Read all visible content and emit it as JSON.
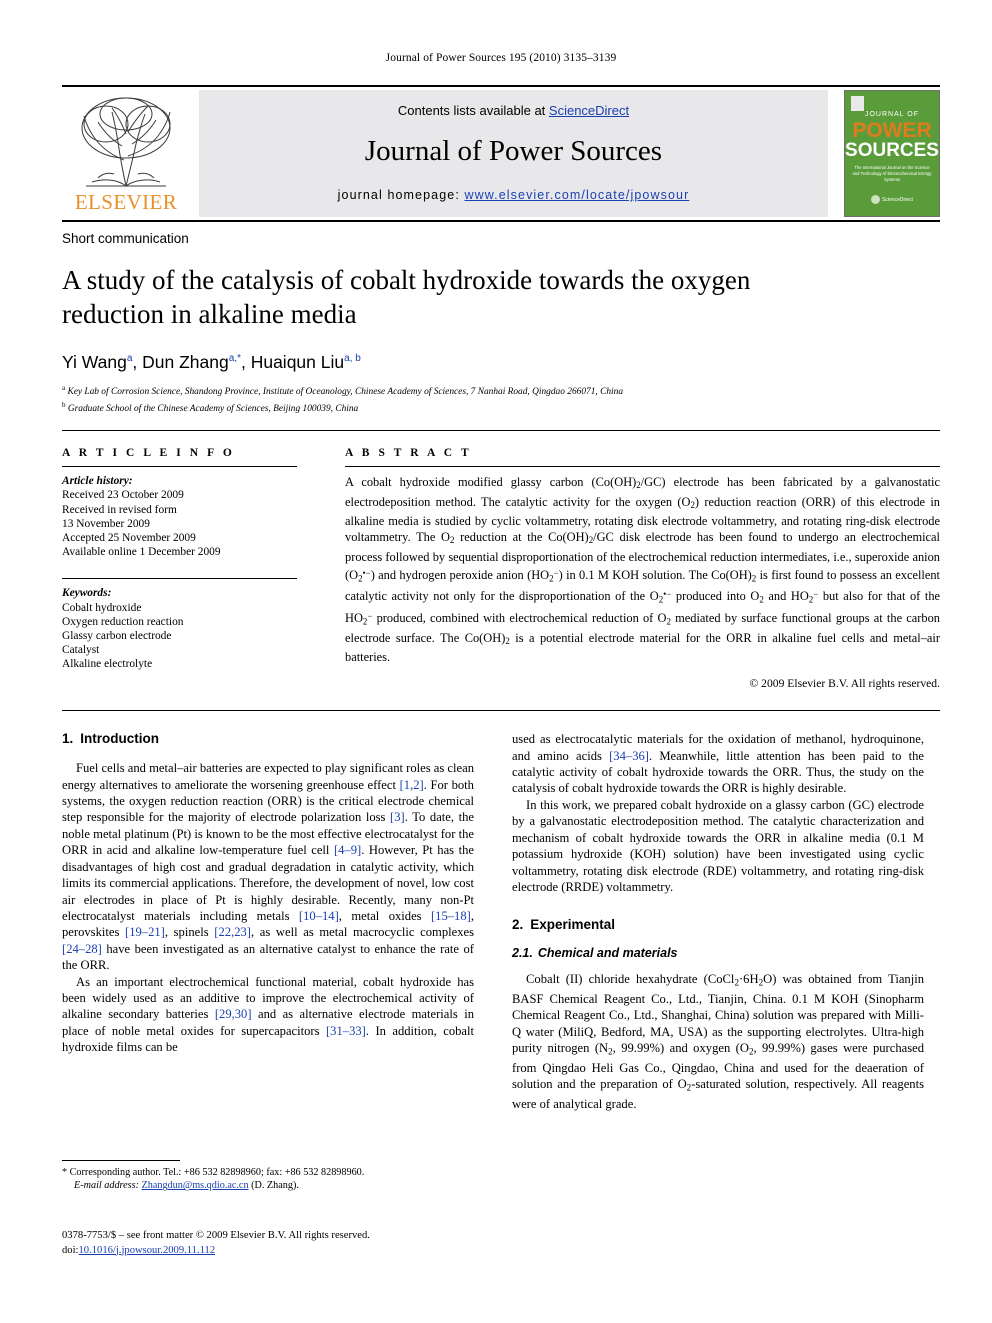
{
  "running_head": "Journal of Power Sources 195 (2010) 3135–3139",
  "masthead": {
    "contents_prefix": "Contents lists available at ",
    "sciencedirect": "ScienceDirect",
    "journal_title": "Journal of Power Sources",
    "homepage_label": "journal homepage:",
    "homepage_url": "www.elsevier.com/locate/jpowsour",
    "publisher": "ELSEVIER",
    "publisher_color": "#E8912B",
    "cover": {
      "line_journal": "JOURNAL OF",
      "line_power": "POWER",
      "line_sources": "SOURCES",
      "subtitle": "The International Journal on the Science and Technology of Electrochemical Energy Systems",
      "footer": "ScienceDirect",
      "bg_color": "#5a9c3a",
      "accent_color": "#e07b20"
    }
  },
  "article": {
    "type": "Short communication",
    "title": "A study of the catalysis of cobalt hydroxide towards the oxygen reduction in alkaline media",
    "authors": [
      {
        "name": "Yi Wang",
        "sup": "a"
      },
      {
        "name": "Dun Zhang",
        "sup": "a,*"
      },
      {
        "name": "Huaiqun Liu",
        "sup": "a, b"
      }
    ],
    "affiliations": [
      {
        "mark": "a",
        "text": "Key Lab of Corrosion Science, Shandong Province, Institute of Oceanology, Chinese Academy of Sciences, 7 Nanhai Road, Qingdao 266071, China"
      },
      {
        "mark": "b",
        "text": "Graduate School of the Chinese Academy of Sciences, Beijing 100039, China"
      }
    ]
  },
  "article_info": {
    "heading": "A R T I C L E   I N F O",
    "history_label": "Article history:",
    "history": [
      "Received 23 October 2009",
      "Received in revised form",
      "13 November 2009",
      "Accepted 25 November 2009",
      "Available online 1 December 2009"
    ],
    "keywords_label": "Keywords:",
    "keywords": [
      "Cobalt hydroxide",
      "Oxygen reduction reaction",
      "Glassy carbon electrode",
      "Catalyst",
      "Alkaline electrolyte"
    ]
  },
  "abstract": {
    "heading": "A B S T R A C T",
    "copyright": "© 2009 Elsevier B.V. All rights reserved."
  },
  "sections": {
    "introduction_heading_num": "1.",
    "introduction_heading": "Introduction",
    "experimental_heading_num": "2.",
    "experimental_heading": "Experimental",
    "chemicals_heading_num": "2.1.",
    "chemicals_heading": "Chemical and materials"
  },
  "footnotes": {
    "corresponding": "* Corresponding author. Tel.: +86 532 82898960; fax: +86 532 82898960.",
    "email_label": "E-mail address:",
    "email": "Zhangdun@ms.qdio.ac.cn",
    "email_suffix": "(D. Zhang)."
  },
  "footer": {
    "issn_line": "0378-7753/$ – see front matter © 2009 Elsevier B.V. All rights reserved.",
    "doi_label": "doi:",
    "doi": "10.1016/j.jpowsour.2009.11.112"
  }
}
